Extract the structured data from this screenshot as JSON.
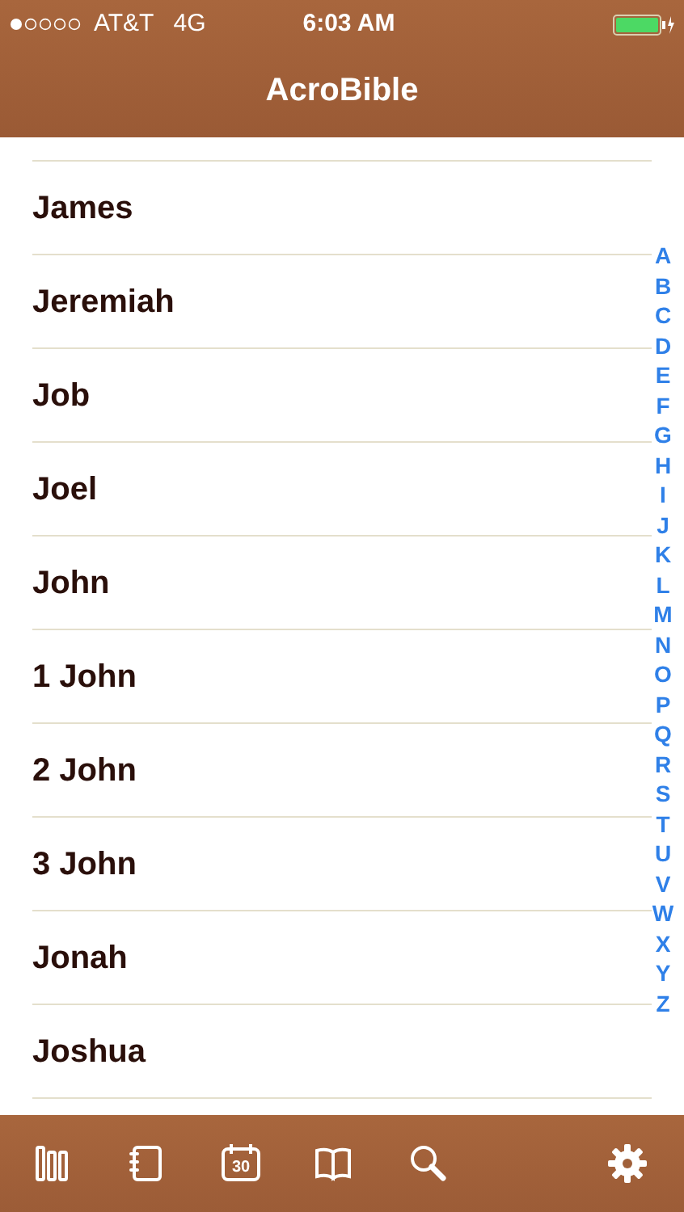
{
  "status_bar": {
    "carrier": "AT&T",
    "network": "4G",
    "time": "6:03 AM"
  },
  "nav": {
    "title": "AcroBible"
  },
  "books": [
    {
      "name": "James"
    },
    {
      "name": "Jeremiah"
    },
    {
      "name": "Job"
    },
    {
      "name": "Joel"
    },
    {
      "name": "John"
    },
    {
      "name": "1 John"
    },
    {
      "name": "2 John"
    },
    {
      "name": "3 John"
    },
    {
      "name": "Jonah"
    },
    {
      "name": "Joshua"
    }
  ],
  "index": [
    "A",
    "B",
    "C",
    "D",
    "E",
    "F",
    "G",
    "H",
    "I",
    "J",
    "K",
    "L",
    "M",
    "N",
    "O",
    "P",
    "Q",
    "R",
    "S",
    "T",
    "U",
    "V",
    "W",
    "X",
    "Y",
    "Z"
  ],
  "tab_bar": [
    {
      "kind": "library"
    },
    {
      "kind": "notebook"
    },
    {
      "kind": "calendar",
      "day": "30"
    },
    {
      "kind": "book"
    },
    {
      "kind": "search"
    },
    {
      "kind": "settings"
    }
  ]
}
